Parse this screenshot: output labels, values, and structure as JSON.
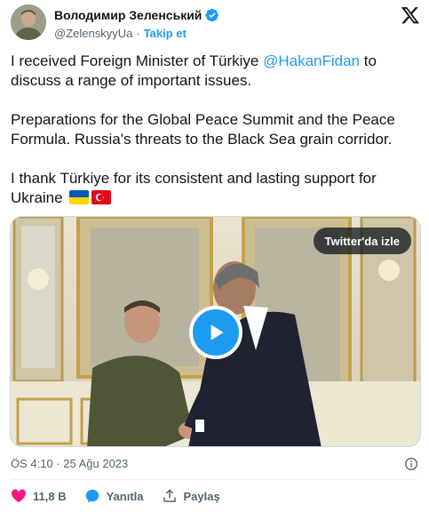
{
  "header": {
    "display_name": "Володимир Зеленський",
    "handle": "@ZelenskyyUa",
    "separator": "·",
    "follow_label": "Takip et"
  },
  "tweet": {
    "line1_pre": "I received Foreign Minister of Türkiye ",
    "mention": "@HakanFidan",
    "line1_post": " to discuss a range of important issues.",
    "para2": "Preparations for the Global Peace Summit and the Peace Formula. Russia's threats to the Black Sea grain corridor.",
    "para3": "I thank Türkiye for its consistent and lasting support for Ukraine"
  },
  "media": {
    "watch_label": "Twitter'da izle"
  },
  "meta": {
    "timestamp": "ÖS 4:10 · 25 Ağu 2023"
  },
  "actions": {
    "like_count": "11,8 B",
    "reply_label": "Yanıtla",
    "share_label": "Paylaş"
  },
  "colors": {
    "accent": "#1d9bf0",
    "like": "#f91880",
    "muted": "#536471"
  }
}
